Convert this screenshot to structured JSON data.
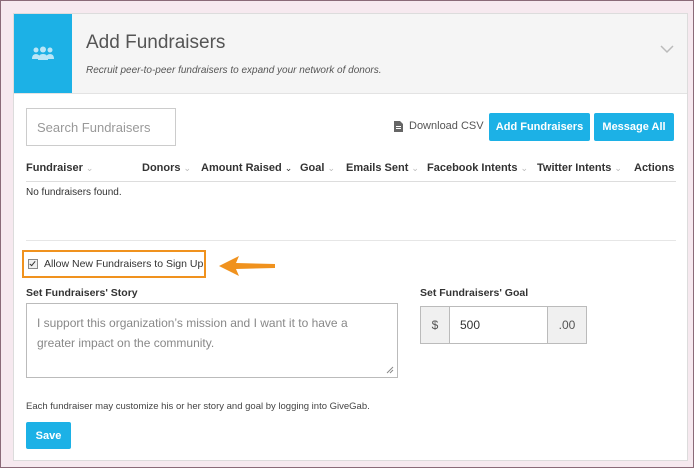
{
  "header": {
    "title": "Add Fundraisers",
    "subtitle": "Recruit peer-to-peer fundraisers to expand your network of donors."
  },
  "toolbar": {
    "search_placeholder": "Search Fundraisers",
    "download_label": "Download CSV",
    "add_label": "Add Fundraisers",
    "message_label": "Message All"
  },
  "table": {
    "columns": [
      "Fundraiser",
      "Donors",
      "Amount Raised",
      "Goal",
      "Emails Sent",
      "Facebook Intents",
      "Twitter Intents",
      "Actions"
    ],
    "empty_text": "No fundraisers found."
  },
  "settings": {
    "allow_label": "Allow New Fundraisers to Sign Up",
    "allow_checked": true,
    "story_label": "Set Fundraisers' Story",
    "story_text": "I support this organization’s mission and I want it to have a greater impact on the community.",
    "goal_label": "Set Fundraisers' Goal",
    "goal_prefix": "$",
    "goal_value": "500",
    "goal_suffix": ".00",
    "note": "Each fundraiser may customize his or her story and goal by logging into GiveGab.",
    "save_label": "Save"
  },
  "colors": {
    "accent": "#1cb1e6",
    "highlight": "#f0921e"
  },
  "icons": [
    "group-icon",
    "chevron-down-icon",
    "document-icon",
    "arrow-left-icon",
    "resize-grip-icon"
  ]
}
